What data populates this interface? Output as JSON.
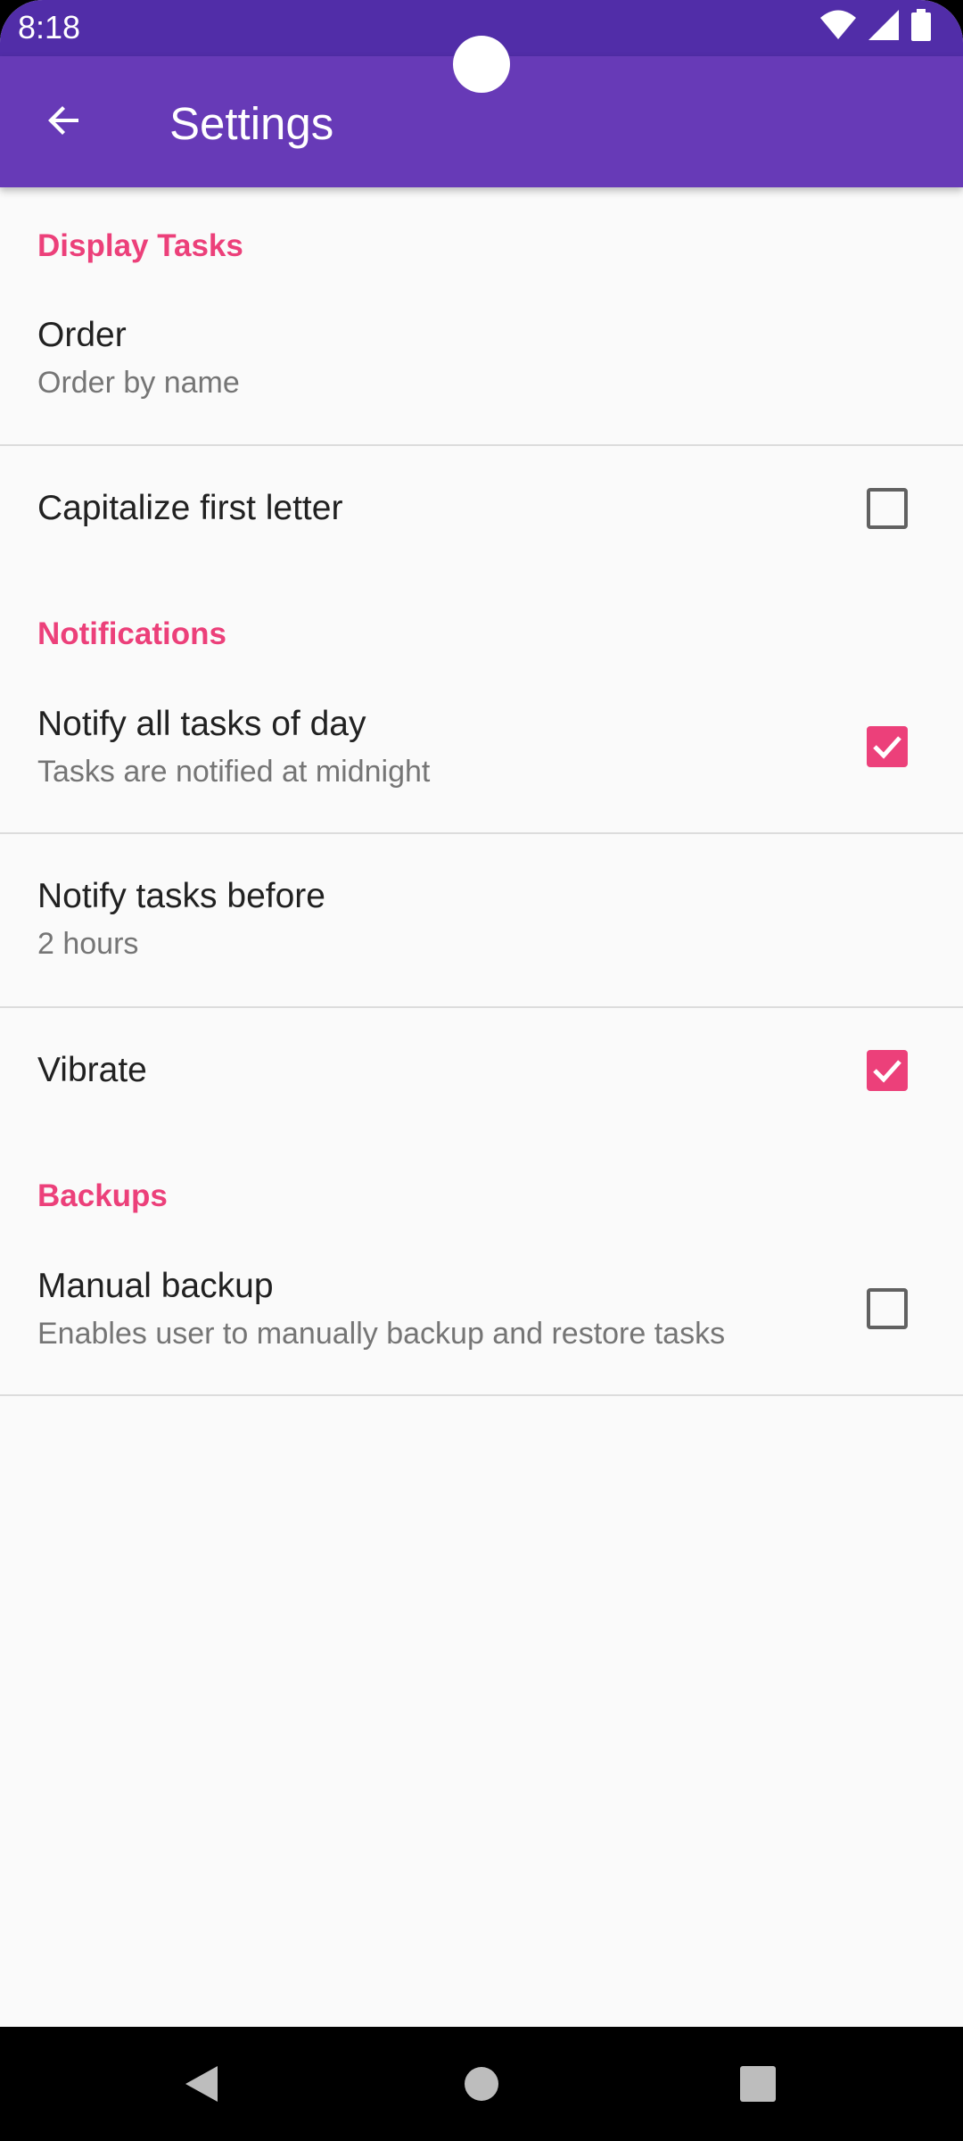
{
  "status_bar": {
    "time": "8:18",
    "icons": [
      "wifi-icon",
      "cell-signal-icon",
      "battery-icon"
    ]
  },
  "app_bar": {
    "title": "Settings",
    "back_icon": "arrow-back-icon"
  },
  "sections": [
    {
      "title": "Display Tasks",
      "prefs": [
        {
          "title": "Order",
          "summary": "Order by name"
        },
        {
          "title": "Capitalize first letter",
          "checked": false
        }
      ]
    },
    {
      "title": "Notifications",
      "prefs": [
        {
          "title": "Notify all tasks of day",
          "summary": "Tasks are notified at midnight",
          "checked": true
        },
        {
          "title": "Notify tasks before",
          "summary": "2 hours"
        },
        {
          "title": "Vibrate",
          "checked": true
        }
      ]
    },
    {
      "title": "Backups",
      "prefs": [
        {
          "title": "Manual backup",
          "summary": "Enables user to manually backup and restore tasks",
          "checked": false
        }
      ]
    }
  ],
  "nav_bar": {
    "buttons": [
      "back-triangle-icon",
      "home-circle-icon",
      "recents-square-icon"
    ]
  },
  "colors": {
    "status_bar": "#512da8",
    "app_bar": "#673ab7",
    "accent": "#ec407a",
    "background": "#fafafa"
  }
}
